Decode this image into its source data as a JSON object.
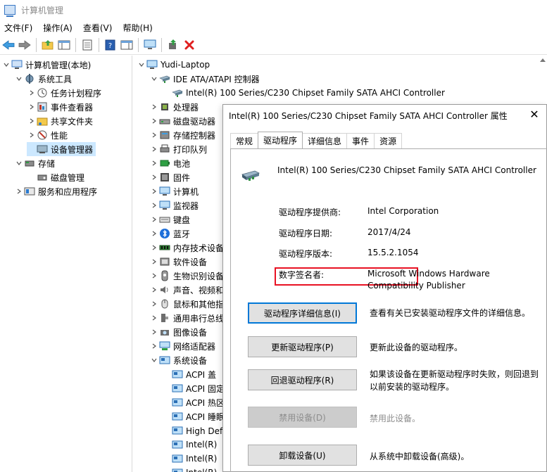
{
  "window": {
    "title": "计算机管理"
  },
  "menu": [
    "文件(F)",
    "操作(A)",
    "查看(V)",
    "帮助(H)"
  ],
  "toolbar": [
    "back-icon",
    "forward-icon",
    "up-folder-icon",
    "console-tree-icon",
    "properties-icon",
    "help-icon",
    "show-hide-icon",
    "monitor-icon",
    "update-driver-icon",
    "uninstall-icon"
  ],
  "left_tree": [
    {
      "label": "计算机管理(本地)",
      "level": 0,
      "expander": "down",
      "icon": "computer-management-icon"
    },
    {
      "label": "系统工具",
      "level": 1,
      "expander": "down",
      "icon": "system-tools-icon"
    },
    {
      "label": "任务计划程序",
      "level": 2,
      "expander": "right",
      "icon": "task-scheduler-icon"
    },
    {
      "label": "事件查看器",
      "level": 2,
      "expander": "right",
      "icon": "event-viewer-icon"
    },
    {
      "label": "共享文件夹",
      "level": 2,
      "expander": "right",
      "icon": "shared-folder-icon"
    },
    {
      "label": "性能",
      "level": 2,
      "expander": "right",
      "icon": "performance-icon"
    },
    {
      "label": "设备管理器",
      "level": 2,
      "expander": "none",
      "icon": "device-manager-icon",
      "selected": true
    },
    {
      "label": "存储",
      "level": 1,
      "expander": "down",
      "icon": "storage-icon"
    },
    {
      "label": "磁盘管理",
      "level": 2,
      "expander": "none",
      "icon": "disk-management-icon"
    },
    {
      "label": "服务和应用程序",
      "level": 1,
      "expander": "right",
      "icon": "services-icon"
    }
  ],
  "device_tree": [
    {
      "label": "Yudi-Laptop",
      "level": 0,
      "expander": "down",
      "icon": "computer-icon"
    },
    {
      "label": "IDE ATA/ATAPI 控制器",
      "level": 1,
      "expander": "down",
      "icon": "ide-controller-icon"
    },
    {
      "label": "Intel(R) 100 Series/C230 Chipset Family SATA AHCI Controller",
      "level": 2,
      "expander": "none",
      "icon": "ide-controller-icon"
    },
    {
      "label": "处理器",
      "level": 1,
      "expander": "right",
      "icon": "processor-icon"
    },
    {
      "label": "磁盘驱动器",
      "level": 1,
      "expander": "right",
      "icon": "disk-drive-icon"
    },
    {
      "label": "存储控制器",
      "level": 1,
      "expander": "right",
      "icon": "storage-controller-icon"
    },
    {
      "label": "打印队列",
      "level": 1,
      "expander": "right",
      "icon": "printer-icon"
    },
    {
      "label": "电池",
      "level": 1,
      "expander": "right",
      "icon": "battery-icon"
    },
    {
      "label": "固件",
      "level": 1,
      "expander": "right",
      "icon": "firmware-icon"
    },
    {
      "label": "计算机",
      "level": 1,
      "expander": "right",
      "icon": "monitor-icon"
    },
    {
      "label": "监视器",
      "level": 1,
      "expander": "right",
      "icon": "monitor-icon"
    },
    {
      "label": "键盘",
      "level": 1,
      "expander": "right",
      "icon": "keyboard-icon"
    },
    {
      "label": "蓝牙",
      "level": 1,
      "expander": "right",
      "icon": "bluetooth-icon"
    },
    {
      "label": "内存技术设备",
      "level": 1,
      "expander": "right",
      "icon": "memory-icon"
    },
    {
      "label": "软件设备",
      "level": 1,
      "expander": "right",
      "icon": "software-device-icon"
    },
    {
      "label": "生物识别设备",
      "level": 1,
      "expander": "right",
      "icon": "biometric-icon"
    },
    {
      "label": "声音、视频和游戏控制器",
      "level": 1,
      "expander": "right",
      "icon": "sound-icon"
    },
    {
      "label": "鼠标和其他指针设备",
      "level": 1,
      "expander": "right",
      "icon": "mouse-icon"
    },
    {
      "label": "通用串行总线控制器",
      "level": 1,
      "expander": "right",
      "icon": "usb-icon"
    },
    {
      "label": "图像设备",
      "level": 1,
      "expander": "right",
      "icon": "camera-icon"
    },
    {
      "label": "网络适配器",
      "level": 1,
      "expander": "right",
      "icon": "network-icon"
    },
    {
      "label": "系统设备",
      "level": 1,
      "expander": "down",
      "icon": "system-device-icon"
    },
    {
      "label": "ACPI 盖",
      "level": 2,
      "expander": "none",
      "icon": "system-device-icon"
    },
    {
      "label": "ACPI 固定功能按钮",
      "level": 2,
      "expander": "none",
      "icon": "system-device-icon"
    },
    {
      "label": "ACPI 热区",
      "level": 2,
      "expander": "none",
      "icon": "system-device-icon"
    },
    {
      "label": "ACPI 睡眠按钮",
      "level": 2,
      "expander": "none",
      "icon": "system-device-icon"
    },
    {
      "label": "High Definition Audio 控制器",
      "level": 2,
      "expander": "none",
      "icon": "system-device-icon"
    },
    {
      "label": "Intel(R)",
      "level": 2,
      "expander": "none",
      "icon": "system-device-icon"
    },
    {
      "label": "Intel(R)",
      "level": 2,
      "expander": "none",
      "icon": "system-device-icon"
    },
    {
      "label": "Intel(R)",
      "level": 2,
      "expander": "none",
      "icon": "system-device-icon"
    }
  ],
  "dialog": {
    "title": "Intel(R) 100 Series/C230 Chipset Family SATA AHCI Controller 属性",
    "close": "✕",
    "tabs": [
      {
        "label": "常规",
        "active": false
      },
      {
        "label": "驱动程序",
        "active": true
      },
      {
        "label": "详细信息",
        "active": false
      },
      {
        "label": "事件",
        "active": false
      },
      {
        "label": "资源",
        "active": false
      }
    ],
    "device_name": "Intel(R) 100 Series/C230 Chipset Family SATA AHCI Controller",
    "fields": {
      "provider_label": "驱动程序提供商:",
      "provider_value": "Intel Corporation",
      "date_label": "驱动程序日期:",
      "date_value": "2017/4/24",
      "version_label": "驱动程序版本:",
      "version_value": "15.5.2.1054",
      "signer_label": "数字签名者:",
      "signer_value_1": "Microsoft Windows Hardware",
      "signer_value_2": "Compatibility Publisher"
    },
    "buttons": [
      {
        "name": "driver-details-button",
        "label": "驱动程序详细信息(I)",
        "desc": "查看有关已安装驱动程序文件的详细信息。",
        "state": "focused"
      },
      {
        "name": "update-driver-button",
        "label": "更新驱动程序(P)",
        "desc": "更新此设备的驱动程序。",
        "state": "normal"
      },
      {
        "name": "roll-back-driver-button",
        "label": "回退驱动程序(R)",
        "desc": "如果该设备在更新驱动程序时失败，则回退到以前安装的驱动程序。",
        "state": "normal"
      },
      {
        "name": "disable-device-button",
        "label": "禁用设备(D)",
        "desc": "禁用此设备。",
        "state": "disabled"
      },
      {
        "name": "uninstall-device-button",
        "label": "卸载设备(U)",
        "desc": "从系统中卸载设备(高级)。",
        "state": "normal"
      }
    ]
  },
  "colors": {
    "selection": "#cce8ff",
    "highlight_box": "#e81123",
    "focus": "#0078d7"
  }
}
